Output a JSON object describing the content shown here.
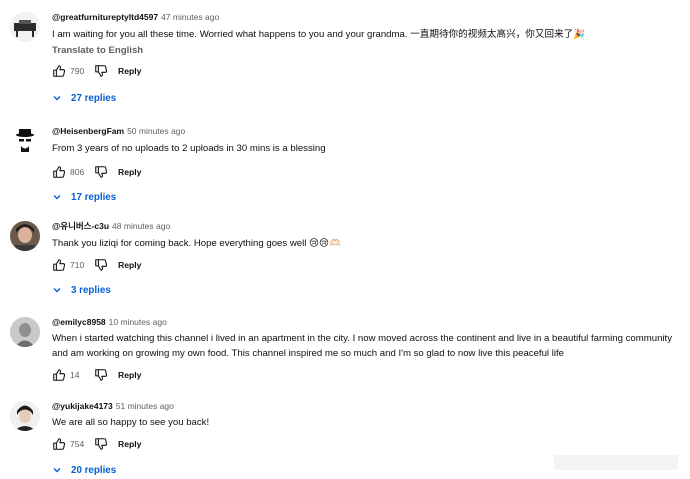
{
  "comments": [
    {
      "author": "@greatfurnitureptyltd4597",
      "time": "47 minutes ago",
      "text": "I am waiting for you all these time. Worried what happens to you and your grandma. 一直期待你的视频太高兴，你又回来了🎉",
      "translate_label": "Translate to English",
      "likes": "790",
      "reply_label": "Reply",
      "replies_label": "27 replies"
    },
    {
      "author": "@HeisenbergFam",
      "time": "50 minutes ago",
      "text": "From 3 years of no uploads to 2 uploads in 30 mins is a blessing",
      "likes": "806",
      "reply_label": "Reply",
      "replies_label": "17 replies"
    },
    {
      "author": "@유니버스-c3u",
      "time": "48 minutes ago",
      "text": "Thank you liziqi for coming back. Hope everything goes well 😢😢🫶🏻",
      "likes": "710",
      "reply_label": "Reply",
      "replies_label": "3 replies"
    },
    {
      "author": "@emilyc8958",
      "time": "10 minutes ago",
      "text": "When i started watching this channel i lived in an apartment in the city. I now moved across the continent and live in a beautiful farming community and am working on growing my own food. This channel inspired me so much and I'm so glad to now live this peaceful life",
      "likes": "14",
      "reply_label": "Reply"
    },
    {
      "author": "@yukijake4173",
      "time": "51 minutes ago",
      "text": "We are all so happy to see you back!",
      "likes": "754",
      "reply_label": "Reply",
      "replies_label": "20 replies"
    }
  ],
  "icons": {
    "like": "thumbs-up-icon",
    "dislike": "thumbs-down-icon",
    "replies": "chevron-down-icon"
  },
  "colors": {
    "link_blue": "#065fd4",
    "secondary_text": "#606060"
  }
}
